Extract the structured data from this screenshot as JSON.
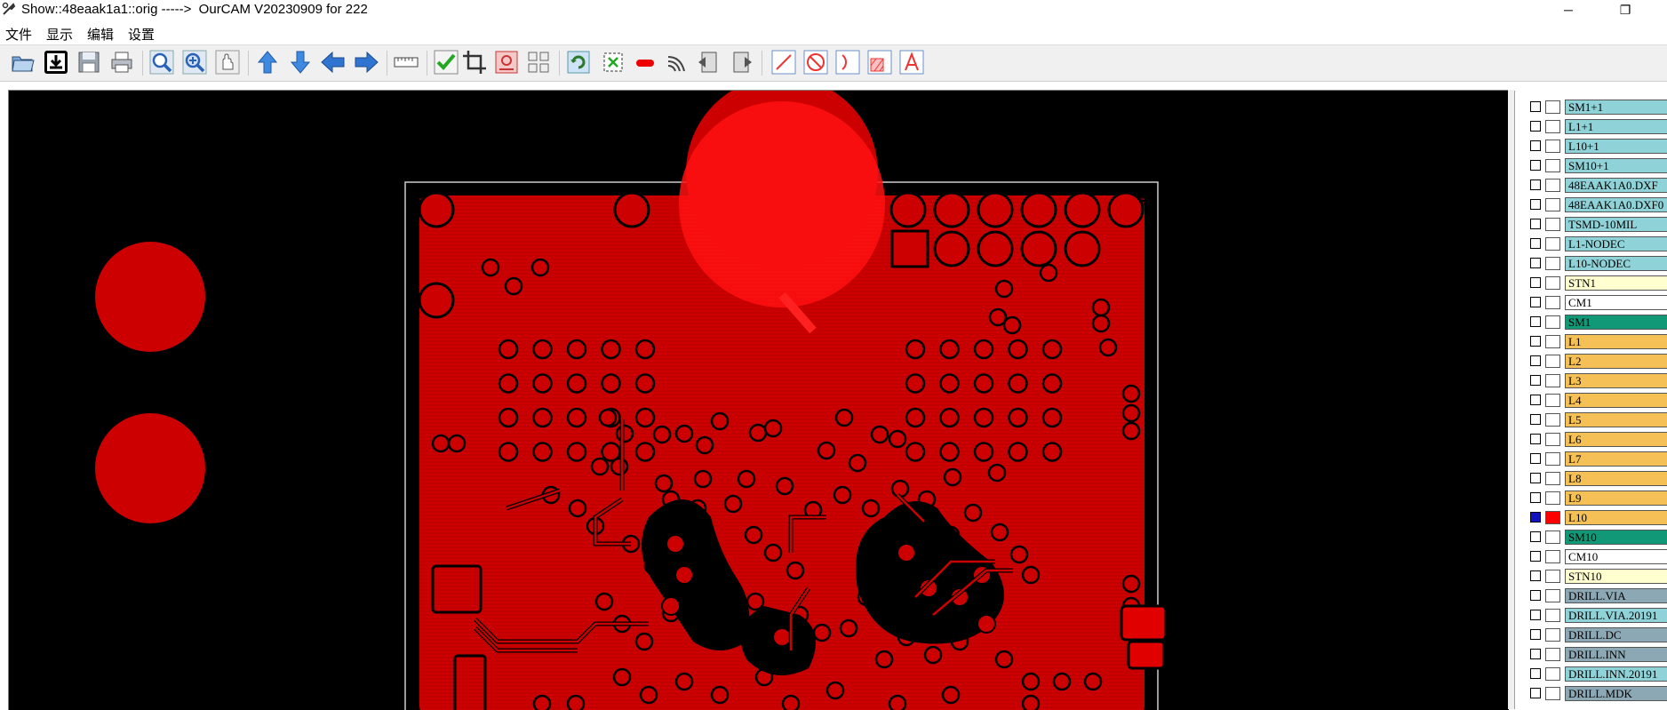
{
  "window": {
    "title": "Show::48eaak1a1::orig ----->  OurCAM V20230909 for 222",
    "minimize_glyph": "─",
    "restore_glyph": "❐"
  },
  "menu": [
    {
      "label": "文件"
    },
    {
      "label": "显示"
    },
    {
      "label": "编辑"
    },
    {
      "label": "设置"
    }
  ],
  "toolbar": [
    {
      "icon": "open-folder-icon"
    },
    {
      "icon": "import-icon"
    },
    {
      "icon": "save-icon"
    },
    {
      "icon": "print-icon"
    },
    {
      "icon": "zoom-in-icon"
    },
    {
      "icon": "zoom-fit-icon"
    },
    {
      "icon": "pan-hand-icon"
    },
    {
      "icon": "arrow-up-icon"
    },
    {
      "icon": "arrow-down-icon"
    },
    {
      "icon": "arrow-left-icon"
    },
    {
      "icon": "arrow-right-icon"
    },
    {
      "icon": "measure-icon"
    },
    {
      "icon": "check-icon"
    },
    {
      "icon": "crop-icon"
    },
    {
      "icon": "layer-image-icon"
    },
    {
      "icon": "grid-icon"
    },
    {
      "icon": "refresh-icon"
    },
    {
      "icon": "select-box-icon"
    },
    {
      "icon": "pad-icon"
    },
    {
      "icon": "arc-route-icon"
    },
    {
      "icon": "copy-left-icon"
    },
    {
      "icon": "copy-right-icon"
    },
    {
      "icon": "line-tool-icon"
    },
    {
      "icon": "no-entry-icon"
    },
    {
      "icon": "arc-tool-icon"
    },
    {
      "icon": "hatch-tool-icon"
    },
    {
      "icon": "text-tool-icon"
    }
  ],
  "layers": [
    {
      "name": "SM1+1",
      "color": "#8fd3d8",
      "active": false
    },
    {
      "name": "L1+1",
      "color": "#8fd3d8",
      "active": false
    },
    {
      "name": "L10+1",
      "color": "#8fd3d8",
      "active": false
    },
    {
      "name": "SM10+1",
      "color": "#8fd3d8",
      "active": false
    },
    {
      "name": "48EAAK1A0.DXF",
      "color": "#8fd3d8",
      "active": false
    },
    {
      "name": "48EAAK1A0.DXF0",
      "color": "#8fd3d8",
      "active": false
    },
    {
      "name": "TSMD-10MIL",
      "color": "#8fd3d8",
      "active": false
    },
    {
      "name": "L1-NODEC",
      "color": "#8fd3d8",
      "active": false
    },
    {
      "name": "L10-NODEC",
      "color": "#8fd3d8",
      "active": false
    },
    {
      "name": "STN1",
      "color": "#ffffd0",
      "active": false
    },
    {
      "name": "CM1",
      "color": "#ffffff",
      "active": false
    },
    {
      "name": "SM1",
      "color": "#119977",
      "active": false
    },
    {
      "name": "L1",
      "color": "#f5c055",
      "active": false
    },
    {
      "name": "L2",
      "color": "#f5c055",
      "active": false
    },
    {
      "name": "L3",
      "color": "#f5c055",
      "active": false
    },
    {
      "name": "L4",
      "color": "#f5c055",
      "active": false
    },
    {
      "name": "L5",
      "color": "#f5c055",
      "active": false
    },
    {
      "name": "L6",
      "color": "#f5c055",
      "active": false
    },
    {
      "name": "L7",
      "color": "#f5c055",
      "active": false
    },
    {
      "name": "L8",
      "color": "#f5c055",
      "active": false
    },
    {
      "name": "L9",
      "color": "#f5c055",
      "active": false
    },
    {
      "name": "L10",
      "color": "#f5c055",
      "active": true
    },
    {
      "name": "SM10",
      "color": "#119977",
      "active": false
    },
    {
      "name": "CM10",
      "color": "#ffffff",
      "active": false
    },
    {
      "name": "STN10",
      "color": "#ffffd0",
      "active": false
    },
    {
      "name": "DRILL.VIA",
      "color": "#8ca8b5",
      "active": false
    },
    {
      "name": "DRILL.VIA.20191",
      "color": "#8fd3d8",
      "active": false
    },
    {
      "name": "DRILL.DC",
      "color": "#8ca8b5",
      "active": false
    },
    {
      "name": "DRILL.INN",
      "color": "#8ca8b5",
      "active": false
    },
    {
      "name": "DRILL.INN.20191",
      "color": "#8fd3d8",
      "active": false
    },
    {
      "name": "DRILL.MDK",
      "color": "#8ca8b5",
      "active": false
    }
  ],
  "colors": {
    "board_copper": "#cc0000",
    "board_copper_bright": "#ff1010",
    "canvas_bg": "#000000",
    "active_layer_marker": "#1010c0",
    "active_layer_swatch": "#ff0000"
  }
}
